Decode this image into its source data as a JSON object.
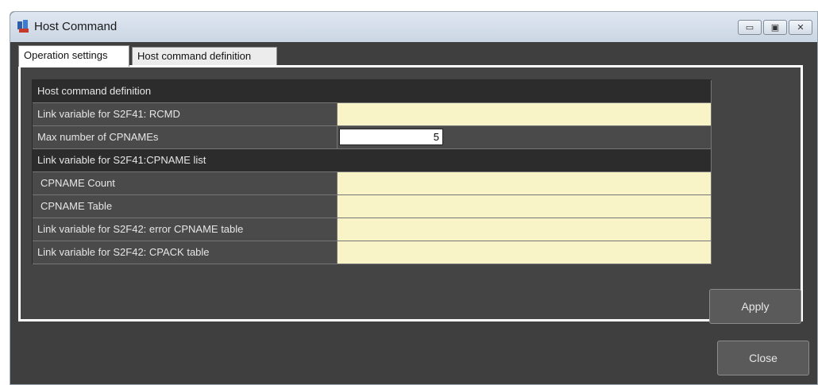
{
  "window": {
    "title": "Host Command",
    "controls": {
      "minimize": "▭",
      "maximize": "▣",
      "close": "✕"
    }
  },
  "tabs": [
    {
      "label": "Operation settings",
      "active": true
    },
    {
      "label": "Host command definition",
      "active": false
    }
  ],
  "grid": {
    "section_header": "Host command definition",
    "rows": [
      {
        "label": "Link variable for S2F41: RCMD",
        "value": ""
      },
      {
        "label": "Max number of CPNAMEs",
        "value": "5"
      }
    ],
    "subsection_header": "Link variable for S2F41:CPNAME list",
    "subrows": [
      {
        "label": "CPNAME Count",
        "value": ""
      },
      {
        "label": "CPNAME Table",
        "value": ""
      },
      {
        "label": "Link variable for S2F42: error CPNAME table",
        "value": ""
      },
      {
        "label": "Link variable for S2F42: CPACK table",
        "value": ""
      }
    ]
  },
  "buttons": {
    "apply": "Apply",
    "close": "Close"
  },
  "colors": {
    "window_bg": "#3f3f3f",
    "field_bg": "#f9f4c8",
    "section_bg": "#2c2c2c"
  }
}
